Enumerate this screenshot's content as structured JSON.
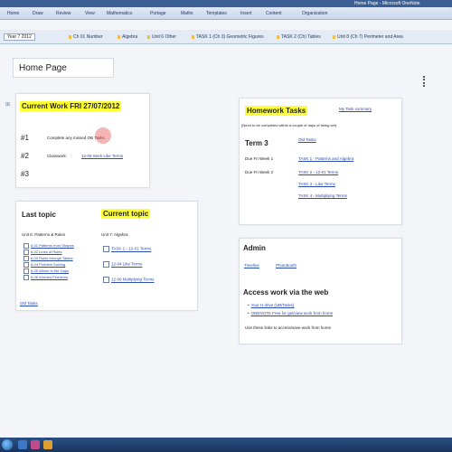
{
  "window": {
    "title": "Home Page - Microsoft OneNote"
  },
  "menu": {
    "items": [
      "Home",
      "Draw",
      "Review",
      "View",
      "Mathematics",
      "Portage",
      "Maths",
      "Templates",
      "Insert",
      "Content",
      "Organization"
    ]
  },
  "notebook_tabs": {
    "notebook": "Year 7 2012",
    "tabs": [
      "Ch 01 Number",
      "Algebra",
      "Unit 6 Other",
      "TASK 1 (Ch 3) Geometric Figures",
      "TASK 2 (Ch) Tables",
      "Unit 8 (Ch 7) Perimeter and Area"
    ]
  },
  "page": {
    "title": "Home Page"
  },
  "current_work": {
    "title": "Current Work  FRI 27/07/2012",
    "rows": [
      {
        "num": "#1",
        "text": "Complete any missed OB Tasks",
        "link": ""
      },
      {
        "num": "#2",
        "text": "Classwork:",
        "link": "12-05 Work Like Terms"
      },
      {
        "num": "#3",
        "text": "",
        "link": ""
      }
    ]
  },
  "topics": {
    "last_heading": "Last topic",
    "current_heading": "Current topic",
    "last_unit": "Unit 6: Patterns & Rules",
    "last_links": [
      "6-01 Patterns from Shapes",
      "6-02 Lines of Rules",
      "6-03 Rules through Tables",
      "6-04 Problem Solving",
      "6-05 Whole in the Gaps",
      "6-06 Worded Problems"
    ],
    "current_unit": "Unit 7: Algebra",
    "current_links": [
      "TASK 1 - 12-01 Terms",
      "12-04 Like Terms",
      "12-06 Multiplying Terms"
    ],
    "old_tasks": "Old Tasks"
  },
  "homework": {
    "title": "Homework Tasks",
    "summary_link": "My Task summary",
    "note": "(Need to be completed within a couple of days of being set)",
    "term": "Term 3",
    "old_tasks": "Old Tasks",
    "rows": [
      {
        "due": "Due Fri Week 1",
        "links": [
          "TASK 1 - Patterns and Algebra"
        ]
      },
      {
        "due": "Due Fri Week 2",
        "links": [
          "TASK 2 - 12-01 Terms",
          "TASK 3 - Like Terms",
          "TASK 4 - Multiplying Terms"
        ]
      }
    ]
  },
  "admin": {
    "title": "Admin",
    "links": [
      "Timeline",
      "Photobooth"
    ],
    "access_title": "Access work via the web",
    "access_links": [
      "Your H drive (UB/Tasks)",
      "ONENOTE Free for get/view work from home"
    ],
    "access_note": "Use these links to access/save work from home"
  },
  "colors": {
    "highlight": "#ffff33",
    "link": "#2a4cb3",
    "titlebar": "#3c5f94"
  }
}
